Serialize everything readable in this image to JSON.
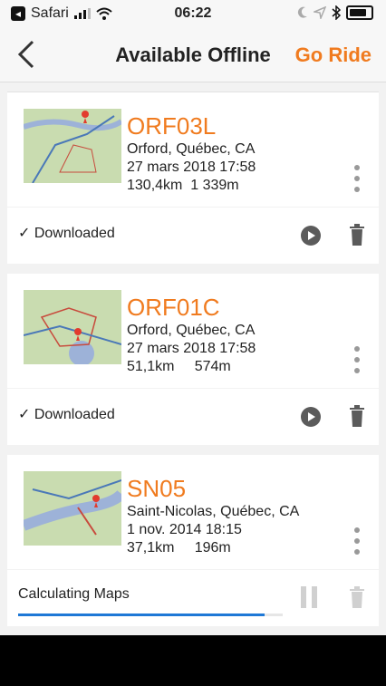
{
  "status_bar": {
    "back_app": "Safari",
    "time": "06:22"
  },
  "nav": {
    "title": "Available Offline",
    "go_ride": "Go Ride"
  },
  "routes": [
    {
      "name": "ORF03L",
      "location": "Orford, Québec, CA",
      "date": "27 mars 2018 17:58",
      "distance": "130,4km",
      "elevation": "1 339m",
      "status_text": "✓ Downloaded",
      "state": "downloaded"
    },
    {
      "name": "ORF01C",
      "location": "Orford, Québec, CA",
      "date": "27 mars 2018 17:58",
      "distance": "51,1km",
      "elevation": "574m",
      "status_text": "✓ Downloaded",
      "state": "downloaded"
    },
    {
      "name": "SN05",
      "location": "Saint-Nicolas, Québec, CA",
      "date": "1 nov. 2014 18:15",
      "distance": "37,1km",
      "elevation": "196m",
      "status_text": "Calculating Maps",
      "state": "calculating",
      "progress": 0.93
    }
  ],
  "colors": {
    "accent": "#f07b1f",
    "progress": "#1e78d6"
  }
}
